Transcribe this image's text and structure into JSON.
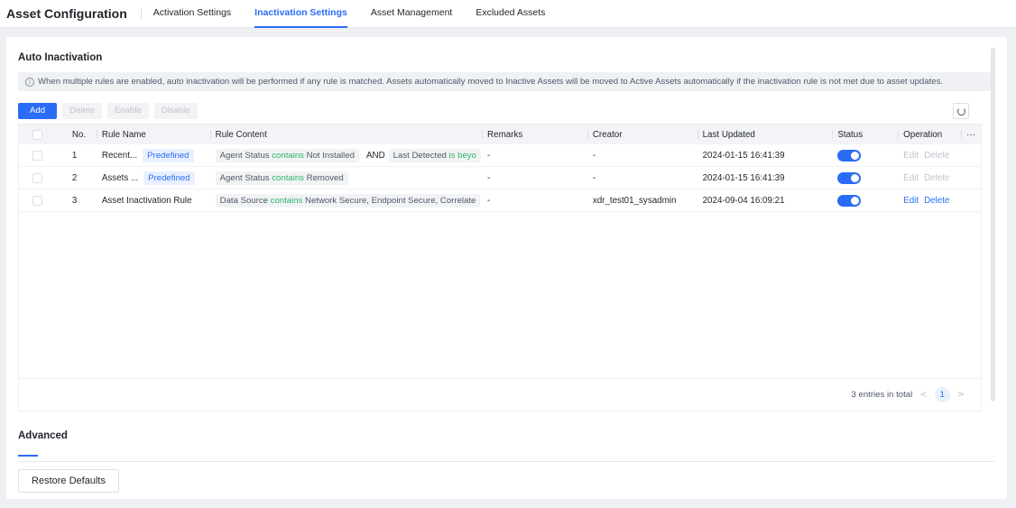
{
  "header": {
    "title": "Asset Configuration",
    "tabs": [
      {
        "label": "Activation Settings"
      },
      {
        "label": "Inactivation Settings"
      },
      {
        "label": "Asset Management"
      },
      {
        "label": "Excluded Assets"
      }
    ]
  },
  "auto": {
    "title": "Auto Inactivation",
    "info": "When multiple rules are enabled, auto inactivation will be performed if any rule is matched. Assets automatically moved to Inactive Assets will be moved to Active Assets automatically if the inactivation rule is not met due to asset updates.",
    "toolbar": {
      "add": "Add",
      "delete": "Delete",
      "enable": "Enable",
      "disable": "Disable"
    },
    "columns": {
      "no": "No.",
      "name": "Rule Name",
      "content": "Rule Content",
      "remarks": "Remarks",
      "creator": "Creator",
      "updated": "Last Updated",
      "status": "Status",
      "operation": "Operation",
      "more": "···"
    },
    "rows": [
      {
        "no": "1",
        "name": "Recent...",
        "tag": "Predefined",
        "c1_field": "Agent Status",
        "c1_op": "contains",
        "c1_value": "Not Installed",
        "and": "AND",
        "c2_field": "Last Detected",
        "c2_op": "is beyo",
        "remarks": "-",
        "creator": "-",
        "updated": "2024-01-15 16:41:39",
        "edit": "Edit",
        "delete": "Delete"
      },
      {
        "no": "2",
        "name": "Assets ...",
        "tag": "Predefined",
        "c1_field": "Agent Status",
        "c1_op": "contains",
        "c1_value": "Removed",
        "remarks": "-",
        "creator": "-",
        "updated": "2024-01-15 16:41:39",
        "edit": "Edit",
        "delete": "Delete"
      },
      {
        "no": "3",
        "name": "Asset Inactivation Rule",
        "c1_field": "Data Source",
        "c1_op": "contains",
        "c1_value": "Network Secure, Endpoint Secure, Correlate",
        "remarks": "-",
        "creator": "xdr_test01_sysadmin",
        "updated": "2024-09-04 16:09:21",
        "edit": "Edit",
        "delete": "Delete"
      }
    ],
    "pagination": {
      "total": "3 entries in total",
      "page": "1",
      "prev": "<",
      "next": ">"
    }
  },
  "advanced": {
    "title": "Advanced",
    "restore": "Restore Defaults"
  },
  "icons": {
    "info": "info-circle-icon",
    "refresh": "refresh-icon"
  },
  "colors": {
    "accent": "#2a6cf5",
    "operator_green": "#2cb46a",
    "disabled": "#c0c4cc"
  }
}
